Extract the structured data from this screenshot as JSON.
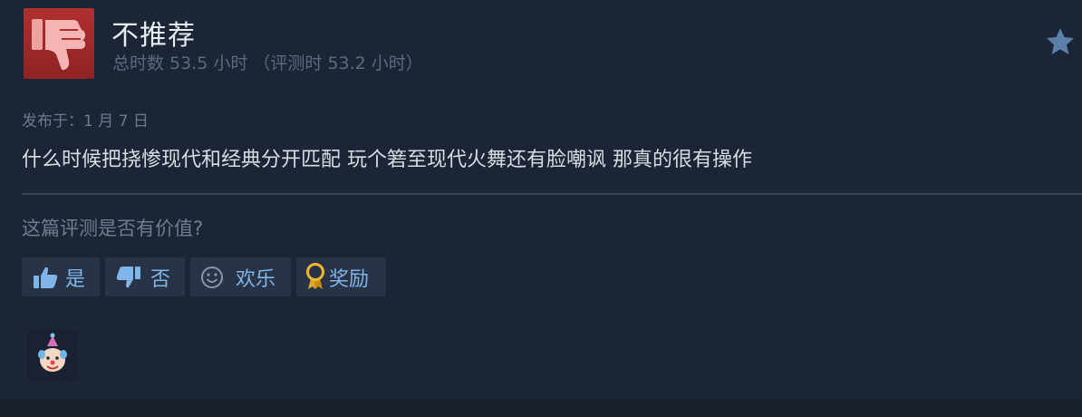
{
  "review": {
    "verdict": "不推荐",
    "playtime": "总时数 53.5 小时 （评测时 53.2 小时）",
    "posted": "发布于：1 月 7 日",
    "body": "什么时候把挠惨现代和经典分开匹配 玩个箬至现代火舞还有脸嘲讽 那真的很有操作",
    "colors": {
      "verdict_bg": "#a52a2a",
      "link_blue": "#7fb5e8",
      "background": "#1c2535"
    }
  },
  "helpful": {
    "question": "这篇评测是否有价值?",
    "yes_label": "是",
    "no_label": "否",
    "funny_label": "欢乐",
    "award_label": "奖励"
  },
  "icons": {
    "verdict": "thumbs-down-icon",
    "favorite": "star-icon",
    "yes": "thumbs-up-icon",
    "no": "thumbs-down-icon",
    "funny": "smiley-icon",
    "award": "award-ribbon-icon",
    "award_given": "clown-face-icon"
  }
}
